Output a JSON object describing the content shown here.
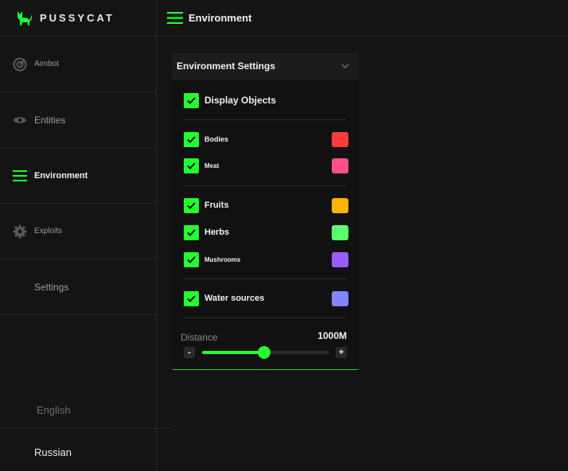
{
  "brand": {
    "name": "PUSSYCAT",
    "icon": "cat-icon",
    "accent": "#23ff2f"
  },
  "nav": [
    {
      "label": "Aimbot",
      "icon": "target-icon"
    },
    {
      "label": "Entities",
      "icon": "eye-icon"
    },
    {
      "label": "Environment",
      "icon": "menu-icon"
    },
    {
      "label": "Exploits",
      "icon": "gear-icon"
    },
    {
      "label": "Settings"
    }
  ],
  "languages": {
    "english": "English",
    "russian": "Russian"
  },
  "header": {
    "title": "Environment",
    "icon": "menu-icon"
  },
  "panel": {
    "title": "Environment Settings",
    "display_objects": {
      "label": "Display Objects",
      "checked": true
    },
    "items": [
      {
        "label": "Bodies",
        "checked": true,
        "color": "#ff3b3b"
      },
      {
        "label": "Meat",
        "checked": true,
        "color": "#ff4f8b"
      },
      {
        "label": "Fruits",
        "checked": true,
        "color": "#ffb300"
      },
      {
        "label": "Herbs",
        "checked": true,
        "color": "#5bff6e"
      },
      {
        "label": "Mushrooms",
        "checked": true,
        "color": "#9b5cff"
      },
      {
        "label": "Water sources",
        "checked": true,
        "color": "#8484ff"
      }
    ],
    "distance": {
      "label": "Distance",
      "value": "1000M",
      "slider_fraction": 0.49,
      "minus": "-",
      "plus": "+"
    }
  }
}
